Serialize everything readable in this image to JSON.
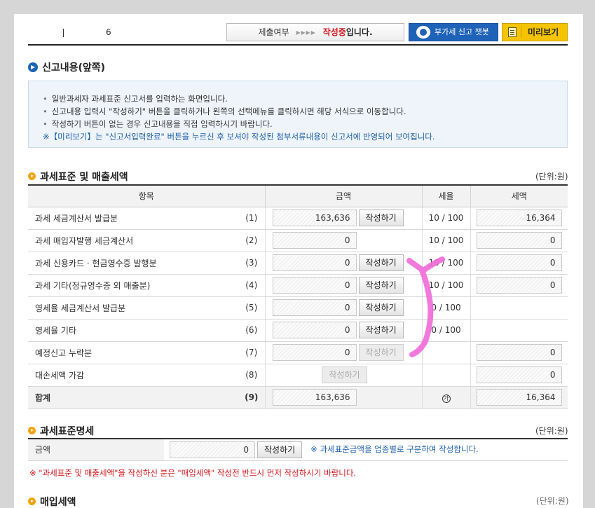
{
  "header": {
    "left_fragment": "6",
    "status_label": "제출여부",
    "status_arrows": "▸▸▸▸",
    "status_current": "작성중",
    "status_tail": "입니다.",
    "chatbot_label": "부가세 신고 챗봇",
    "preview_label": "미리보기"
  },
  "section1": {
    "title": "신고내용(앞쪽)",
    "info_lines": [
      "일반과세자 과세표준 신고서를 입력하는 화면입니다.",
      "신고내용 입력시 \"작성하기\" 버튼을 클릭하거나 왼쪽의 선택메뉴를 클릭하시면 해당 서식으로 이동합니다.",
      "작성하기 버튼이 없는 경우 신고내용을 직접 입력하시기 바랍니다."
    ],
    "info_note": "※【미리보기】는 \"신고서입력완료\" 버튼을 누르신 후 보셔야 작성된 첨부서류내용이 신고서에 반영되어 보여집니다."
  },
  "section2": {
    "title": "과세표준 및 매출세액",
    "unit": "(단위:원)",
    "headers": {
      "item": "항목",
      "amount": "금액",
      "rate": "세율",
      "tax": "세액"
    },
    "rows": [
      {
        "item": "과세 세금계산서 발급분",
        "num": "(1)",
        "amount": "163,636",
        "btn": "작성하기",
        "rate": "10 / 100",
        "tax": "16,364"
      },
      {
        "item": "과세 매입자발행 세금계산서",
        "num": "(2)",
        "amount": "0",
        "btn": "",
        "rate": "10 / 100",
        "tax": "0"
      },
      {
        "item": "과세 신용카드 · 현금영수증 발행분",
        "num": "(3)",
        "amount": "0",
        "btn": "작성하기",
        "rate": "10 / 100",
        "tax": "0"
      },
      {
        "item": "과세 기타(정규영수증 외 매출분)",
        "num": "(4)",
        "amount": "0",
        "btn": "작성하기",
        "rate": "10 / 100",
        "tax": "0"
      },
      {
        "item": "영세율 세금계산서 발급분",
        "num": "(5)",
        "amount": "0",
        "btn": "작성하기",
        "rate": "0 / 100",
        "tax": ""
      },
      {
        "item": "영세율 기타",
        "num": "(6)",
        "amount": "0",
        "btn": "작성하기",
        "rate": "0 / 100",
        "tax": ""
      },
      {
        "item": "예정신고 누락분",
        "num": "(7)",
        "amount": "0",
        "btn": "작성하기",
        "btn_disabled": true,
        "rate": "",
        "tax": "0"
      },
      {
        "item": "대손세액 가감",
        "num": "(8)",
        "amount": "",
        "btn": "작성하기",
        "btn_disabled": true,
        "rate": "",
        "tax": "0"
      }
    ],
    "total": {
      "item": "합계",
      "num": "(9)",
      "amount": "163,636",
      "rate_mark": "가",
      "tax": "16,364"
    }
  },
  "section3": {
    "title": "과세표준명세",
    "unit": "(단위:원)",
    "label": "금액",
    "amount": "0",
    "btn": "작성하기",
    "note": "※ 과세표준금액을 업종별로 구분하여 작성합니다."
  },
  "warning": "※ \"과세표준 및 매출세액\"을 작성하신 분은 \"매입세액\" 작성전 반드시 먼저 작성하시기 바랍니다.",
  "next_section": {
    "title": "매입세액",
    "unit": "(단위:원)"
  },
  "colors": {
    "accent_blue": "#1e63b8",
    "alert_red": "#d2141a",
    "preview_yellow": "#f5c400",
    "annotation_pink": "#f06ad8"
  }
}
